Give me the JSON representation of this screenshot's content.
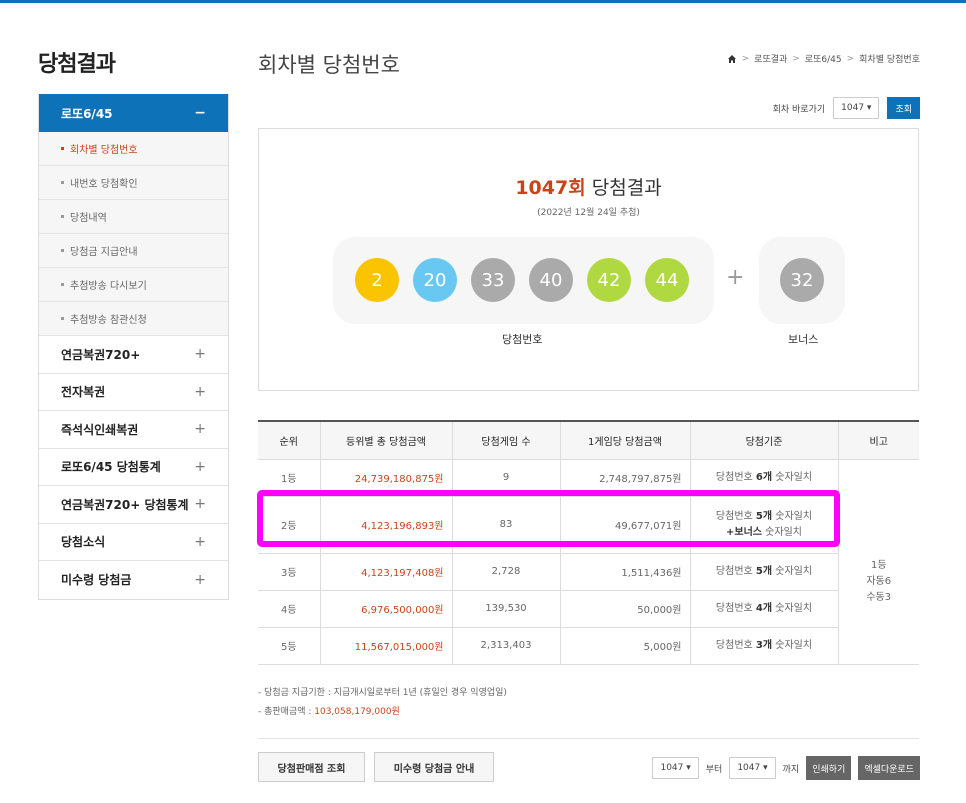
{
  "sidebar": {
    "title": "당첨결과",
    "section_title": "로또6/45",
    "section_toggle": "−",
    "sub_items": [
      {
        "label": "회차별 당첨번호"
      },
      {
        "label": "내번호 당첨확인"
      },
      {
        "label": "당첨내역"
      },
      {
        "label": "당첨금 지급안내"
      },
      {
        "label": "추첨방송 다시보기"
      },
      {
        "label": "추첨방송 참관신청"
      }
    ],
    "main_items": [
      {
        "label": "연금복권720+"
      },
      {
        "label": "전자복권"
      },
      {
        "label": "즉석식인쇄복권"
      },
      {
        "label": "로또6/45 당첨통계"
      },
      {
        "label": "연금복권720+ 당첨통계"
      },
      {
        "label": "당첨소식"
      },
      {
        "label": "미수령 당첨금"
      }
    ],
    "expand_symbol": "+"
  },
  "header": {
    "title": "회차별 당첨번호",
    "breadcrumb": [
      "로또결과",
      "로또6/45",
      "회차별 당첨번호"
    ],
    "breadcrumb_sep": ">"
  },
  "round_select": {
    "label": "회차 바로가기",
    "value": "1047 ▾",
    "button": "조회"
  },
  "result": {
    "round": "1047회",
    "title_suffix": "당첨결과",
    "date": "(2022년 12월 24일 추첨)",
    "numbers": [
      "2",
      "20",
      "33",
      "40",
      "42",
      "44"
    ],
    "plus": "+",
    "bonus": "32",
    "numbers_label": "당첨번호",
    "bonus_label": "보너스",
    "colors": {
      "yellow": "#fbc400",
      "blue": "#69c8f2",
      "gray": "#aaaaaa",
      "green": "#b0d840",
      "accent": "#c8441a",
      "brand": "#0e72b8"
    }
  },
  "table": {
    "headers": [
      "순위",
      "등위별 총 당첨금액",
      "당첨게임 수",
      "1게임당 당첨금액",
      "당첨기준",
      "비고"
    ],
    "rows": [
      {
        "rank": "1등",
        "total": "24,739,180,875원",
        "games": "9",
        "per": "2,748,797,875원",
        "crit_a": "당첨번호 ",
        "crit_b": "6개",
        "crit_c": " 숫자일치",
        "crit2": ""
      },
      {
        "rank": "2등",
        "total": "4,123,196,893원",
        "games": "83",
        "per": "49,677,071원",
        "crit_a": "당첨번호 ",
        "crit_b": "5개",
        "crit_c": " 숫자일치",
        "crit2": "+보너스",
        "crit2_suffix": " 숫자일치"
      },
      {
        "rank": "3등",
        "total": "4,123,197,408원",
        "games": "2,728",
        "per": "1,511,436원",
        "crit_a": "당첨번호 ",
        "crit_b": "5개",
        "crit_c": " 숫자일치",
        "crit2": ""
      },
      {
        "rank": "4등",
        "total": "6,976,500,000원",
        "games": "139,530",
        "per": "50,000원",
        "crit_a": "당첨번호 ",
        "crit_b": "4개",
        "crit_c": " 숫자일치",
        "crit2": ""
      },
      {
        "rank": "5등",
        "total": "11,567,015,000원",
        "games": "2,313,403",
        "per": "5,000원",
        "crit_a": "당첨번호 ",
        "crit_b": "3개",
        "crit_c": " 숫자일치",
        "crit2": ""
      }
    ],
    "note": [
      "1등",
      "자동6",
      "수동3"
    ]
  },
  "notes": {
    "line1": "당첨금 지급기한 : 지급개시일로부터 1년 (휴일인 경우 익영업일)",
    "line2_label": "총판매금액 : ",
    "line2_value": "103,058,179,000원"
  },
  "bottom": {
    "store_button": "당첨판매점 조회",
    "unclaimed_button": "미수령 당첨금 안내",
    "from_value": "1047 ▾",
    "from_label": "부터",
    "to_value": "1047 ▾",
    "to_label": "까지",
    "print_button": "인쇄하기",
    "excel_button": "엑셀다운로드"
  }
}
